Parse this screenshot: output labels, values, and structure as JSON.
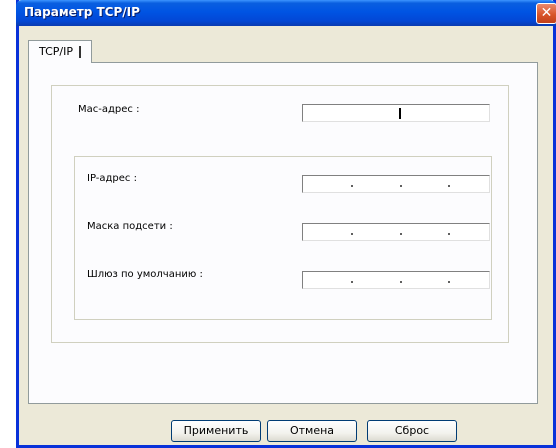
{
  "window": {
    "title": "Параметр TCP/IP",
    "close_icon": "close-icon"
  },
  "tabs": [
    {
      "label": "TCP/IP",
      "active": true
    }
  ],
  "fields": {
    "mac": {
      "label": "Mac-адрес :",
      "value": ""
    },
    "ip": {
      "label": "IP-адрес :",
      "value": ""
    },
    "subnet": {
      "label": "Маска подсети :",
      "value": ""
    },
    "gateway": {
      "label": "Шлюз по умолчанию :",
      "value": ""
    }
  },
  "buttons": {
    "apply": "Применить",
    "cancel": "Отмена",
    "reset": "Сброс"
  },
  "colors": {
    "titlebar": "#0054e3",
    "window_bg": "#ece9d8",
    "panel_bg": "#fcfcfe",
    "close_button": "#d9552a"
  }
}
